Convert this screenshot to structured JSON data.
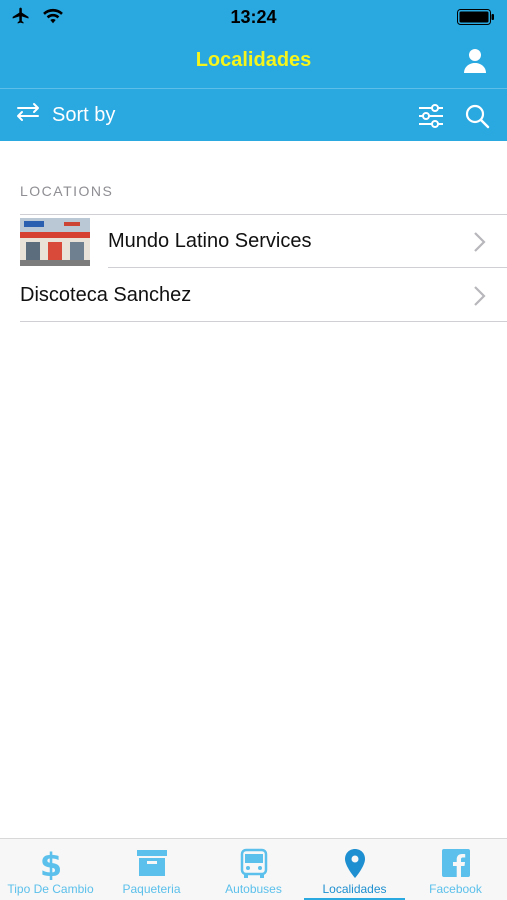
{
  "status_bar": {
    "time": "13:24",
    "icons": [
      "airplane-icon",
      "wifi-icon",
      "battery-icon"
    ]
  },
  "nav": {
    "title": "Localidades",
    "title_color": "#F5F51B",
    "accent": "#2AA8E0",
    "user_icon": "user-icon"
  },
  "toolbar": {
    "sort_label": "Sort by",
    "sort_icon": "swap-arrows-icon",
    "filter_icon": "sliders-icon",
    "search_icon": "search-icon"
  },
  "section": {
    "header": "LOCATIONS"
  },
  "locations": [
    {
      "name": "Mundo Latino Services",
      "has_thumbnail": true
    },
    {
      "name": "Discoteca Sanchez",
      "has_thumbnail": false
    }
  ],
  "tabs": [
    {
      "label": "Tipo De Cambio",
      "icon": "dollar-icon",
      "active": false
    },
    {
      "label": "Paqueteria",
      "icon": "box-icon",
      "active": false
    },
    {
      "label": "Autobuses",
      "icon": "bus-icon",
      "active": false
    },
    {
      "label": "Localidades",
      "icon": "map-pin-icon",
      "active": true
    },
    {
      "label": "Facebook",
      "icon": "facebook-icon",
      "active": false
    }
  ]
}
